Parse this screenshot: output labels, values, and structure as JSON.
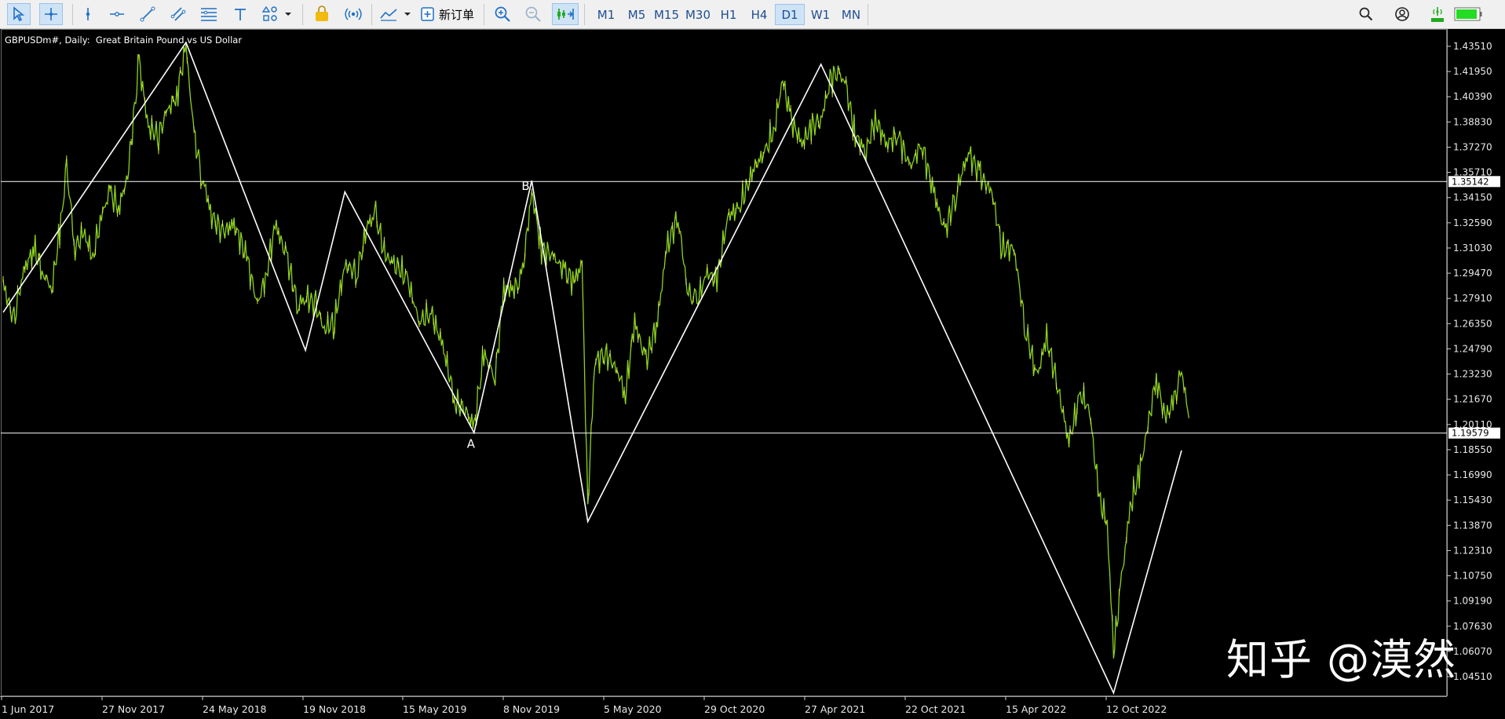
{
  "toolbar": {
    "order_label": "新订单",
    "timeframes": [
      "M1",
      "M5",
      "M15",
      "M30",
      "H1",
      "H4",
      "D1",
      "W1",
      "MN"
    ],
    "active_timeframe": "D1",
    "icons": [
      "cursor-arrow-icon",
      "crosshair-icon",
      "vertical-line-icon",
      "horizontal-line-icon",
      "trendline-icon",
      "channel-icon",
      "fibonacci-icon",
      "text-icon",
      "shapes-icon",
      "dropdown-icon",
      "bag-icon",
      "signal-icon",
      "indicator-icon",
      "dropdown-icon",
      "add-order-icon",
      "zoom-in-icon",
      "zoom-out-icon",
      "autoscroll-icon",
      "search-icon",
      "account-icon",
      "signal-level-icon",
      "battery-icon"
    ],
    "accent_color": "#1f6fc4",
    "level_color": "#22aa22"
  },
  "chart_title": "GBPUSDm#, Daily:  Great Britain Pound vs US Dollar",
  "watermark": "知乎 @漠然",
  "chart_data": {
    "type": "line",
    "title": "GBPUSDm#, Daily:  Great Britain Pound vs US Dollar",
    "xlabel": "",
    "ylabel": "",
    "ylim": [
      1.031,
      1.4415
    ],
    "y_ticks": [
      "1.43510",
      "1.41950",
      "1.40390",
      "1.38830",
      "1.37270",
      "1.35710",
      "1.34150",
      "1.32590",
      "1.31030",
      "1.29470",
      "1.27910",
      "1.26350",
      "1.24790",
      "1.23230",
      "1.21670",
      "1.20110",
      "1.18550",
      "1.16990",
      "1.15430",
      "1.13870",
      "1.12310",
      "1.10750",
      "1.09190",
      "1.07630",
      "1.06070",
      "1.04510"
    ],
    "x_ticks": [
      "1 Jun 2017",
      "27 Nov 2017",
      "24 May 2018",
      "19 Nov 2018",
      "15 May 2019",
      "8 Nov 2019",
      "5 May 2020",
      "29 Oct 2020",
      "27 Apr 2021",
      "22 Oct 2021",
      "15 Apr 2022",
      "12 Oct 2022"
    ],
    "price_line_color": "#8cd21e",
    "horizontal_lines": [
      {
        "value": 1.35142,
        "label": "1.35142"
      },
      {
        "value": 1.19579,
        "label": "1.19579"
      }
    ],
    "zigzag": [
      {
        "x": "2017-06-01",
        "y": 1.2705
      },
      {
        "x": "2018-04-17",
        "y": 1.4375
      },
      {
        "x": "2018-11-12",
        "y": 1.247
      },
      {
        "x": "2019-01-20",
        "y": 1.345
      },
      {
        "x": "2019-09-03",
        "y": 1.196
      },
      {
        "x": "2019-12-13",
        "y": 1.352
      },
      {
        "x": "2020-03-20",
        "y": 1.141
      },
      {
        "x": "2021-05-02",
        "y": 1.424
      },
      {
        "x": "2022-09-26",
        "y": 1.035
      },
      {
        "x": "2023-01-23",
        "y": 1.185
      }
    ],
    "point_labels": [
      {
        "text": "A",
        "x": "2019-09-03",
        "y": 1.196
      },
      {
        "text": "B",
        "x": "2019-12-13",
        "y": 1.352
      }
    ],
    "price_series": [
      {
        "x": "2017-06-01",
        "y": 1.288
      },
      {
        "x": "2017-06-20",
        "y": 1.265
      },
      {
        "x": "2017-07-05",
        "y": 1.295
      },
      {
        "x": "2017-07-25",
        "y": 1.31
      },
      {
        "x": "2017-08-10",
        "y": 1.295
      },
      {
        "x": "2017-08-25",
        "y": 1.285
      },
      {
        "x": "2017-09-10",
        "y": 1.325
      },
      {
        "x": "2017-09-20",
        "y": 1.36
      },
      {
        "x": "2017-10-05",
        "y": 1.31
      },
      {
        "x": "2017-10-20",
        "y": 1.32
      },
      {
        "x": "2017-11-05",
        "y": 1.305
      },
      {
        "x": "2017-11-20",
        "y": 1.33
      },
      {
        "x": "2017-12-05",
        "y": 1.345
      },
      {
        "x": "2017-12-20",
        "y": 1.335
      },
      {
        "x": "2018-01-05",
        "y": 1.355
      },
      {
        "x": "2018-01-25",
        "y": 1.425
      },
      {
        "x": "2018-02-10",
        "y": 1.385
      },
      {
        "x": "2018-02-28",
        "y": 1.38
      },
      {
        "x": "2018-03-15",
        "y": 1.395
      },
      {
        "x": "2018-04-01",
        "y": 1.405
      },
      {
        "x": "2018-04-17",
        "y": 1.435
      },
      {
        "x": "2018-05-01",
        "y": 1.38
      },
      {
        "x": "2018-05-15",
        "y": 1.355
      },
      {
        "x": "2018-06-01",
        "y": 1.33
      },
      {
        "x": "2018-06-20",
        "y": 1.32
      },
      {
        "x": "2018-07-10",
        "y": 1.325
      },
      {
        "x": "2018-08-01",
        "y": 1.305
      },
      {
        "x": "2018-08-20",
        "y": 1.275
      },
      {
        "x": "2018-09-05",
        "y": 1.295
      },
      {
        "x": "2018-09-20",
        "y": 1.325
      },
      {
        "x": "2018-10-10",
        "y": 1.305
      },
      {
        "x": "2018-10-30",
        "y": 1.275
      },
      {
        "x": "2018-11-12",
        "y": 1.28
      },
      {
        "x": "2018-11-30",
        "y": 1.275
      },
      {
        "x": "2018-12-15",
        "y": 1.26
      },
      {
        "x": "2019-01-02",
        "y": 1.265
      },
      {
        "x": "2019-01-20",
        "y": 1.3
      },
      {
        "x": "2019-02-10",
        "y": 1.295
      },
      {
        "x": "2019-03-01",
        "y": 1.325
      },
      {
        "x": "2019-03-15",
        "y": 1.33
      },
      {
        "x": "2019-04-01",
        "y": 1.305
      },
      {
        "x": "2019-04-20",
        "y": 1.3
      },
      {
        "x": "2019-05-10",
        "y": 1.29
      },
      {
        "x": "2019-05-30",
        "y": 1.265
      },
      {
        "x": "2019-06-20",
        "y": 1.27
      },
      {
        "x": "2019-07-10",
        "y": 1.25
      },
      {
        "x": "2019-08-01",
        "y": 1.215
      },
      {
        "x": "2019-08-20",
        "y": 1.21
      },
      {
        "x": "2019-09-03",
        "y": 1.199
      },
      {
        "x": "2019-09-20",
        "y": 1.245
      },
      {
        "x": "2019-10-10",
        "y": 1.23
      },
      {
        "x": "2019-10-25",
        "y": 1.285
      },
      {
        "x": "2019-11-10",
        "y": 1.285
      },
      {
        "x": "2019-11-25",
        "y": 1.29
      },
      {
        "x": "2019-12-13",
        "y": 1.345
      },
      {
        "x": "2019-12-30",
        "y": 1.31
      },
      {
        "x": "2020-01-20",
        "y": 1.305
      },
      {
        "x": "2020-02-10",
        "y": 1.295
      },
      {
        "x": "2020-02-25",
        "y": 1.29
      },
      {
        "x": "2020-03-10",
        "y": 1.3
      },
      {
        "x": "2020-03-20",
        "y": 1.15
      },
      {
        "x": "2020-04-01",
        "y": 1.24
      },
      {
        "x": "2020-04-20",
        "y": 1.245
      },
      {
        "x": "2020-05-10",
        "y": 1.235
      },
      {
        "x": "2020-05-25",
        "y": 1.22
      },
      {
        "x": "2020-06-10",
        "y": 1.265
      },
      {
        "x": "2020-06-30",
        "y": 1.24
      },
      {
        "x": "2020-07-20",
        "y": 1.265
      },
      {
        "x": "2020-08-05",
        "y": 1.31
      },
      {
        "x": "2020-08-25",
        "y": 1.33
      },
      {
        "x": "2020-09-10",
        "y": 1.285
      },
      {
        "x": "2020-09-25",
        "y": 1.275
      },
      {
        "x": "2020-10-15",
        "y": 1.295
      },
      {
        "x": "2020-11-01",
        "y": 1.29
      },
      {
        "x": "2020-11-20",
        "y": 1.33
      },
      {
        "x": "2020-12-10",
        "y": 1.335
      },
      {
        "x": "2021-01-05",
        "y": 1.36
      },
      {
        "x": "2021-01-25",
        "y": 1.37
      },
      {
        "x": "2021-02-10",
        "y": 1.385
      },
      {
        "x": "2021-02-24",
        "y": 1.415
      },
      {
        "x": "2021-03-10",
        "y": 1.39
      },
      {
        "x": "2021-03-30",
        "y": 1.375
      },
      {
        "x": "2021-04-15",
        "y": 1.385
      },
      {
        "x": "2021-05-02",
        "y": 1.39
      },
      {
        "x": "2021-05-20",
        "y": 1.415
      },
      {
        "x": "2021-06-01",
        "y": 1.42
      },
      {
        "x": "2021-06-15",
        "y": 1.41
      },
      {
        "x": "2021-07-01",
        "y": 1.38
      },
      {
        "x": "2021-07-20",
        "y": 1.37
      },
      {
        "x": "2021-08-05",
        "y": 1.39
      },
      {
        "x": "2021-08-25",
        "y": 1.375
      },
      {
        "x": "2021-09-15",
        "y": 1.38
      },
      {
        "x": "2021-10-05",
        "y": 1.36
      },
      {
        "x": "2021-10-25",
        "y": 1.375
      },
      {
        "x": "2021-11-15",
        "y": 1.345
      },
      {
        "x": "2021-12-05",
        "y": 1.32
      },
      {
        "x": "2021-12-25",
        "y": 1.345
      },
      {
        "x": "2022-01-15",
        "y": 1.37
      },
      {
        "x": "2022-02-05",
        "y": 1.355
      },
      {
        "x": "2022-02-25",
        "y": 1.345
      },
      {
        "x": "2022-03-15",
        "y": 1.31
      },
      {
        "x": "2022-04-05",
        "y": 1.31
      },
      {
        "x": "2022-04-25",
        "y": 1.26
      },
      {
        "x": "2022-05-15",
        "y": 1.23
      },
      {
        "x": "2022-06-01",
        "y": 1.255
      },
      {
        "x": "2022-06-20",
        "y": 1.225
      },
      {
        "x": "2022-07-10",
        "y": 1.19
      },
      {
        "x": "2022-07-30",
        "y": 1.22
      },
      {
        "x": "2022-08-15",
        "y": 1.21
      },
      {
        "x": "2022-09-01",
        "y": 1.155
      },
      {
        "x": "2022-09-15",
        "y": 1.14
      },
      {
        "x": "2022-09-26",
        "y": 1.06
      },
      {
        "x": "2022-10-10",
        "y": 1.105
      },
      {
        "x": "2022-10-25",
        "y": 1.15
      },
      {
        "x": "2022-11-10",
        "y": 1.17
      },
      {
        "x": "2022-11-25",
        "y": 1.2
      },
      {
        "x": "2022-12-10",
        "y": 1.23
      },
      {
        "x": "2022-12-25",
        "y": 1.205
      },
      {
        "x": "2023-01-10",
        "y": 1.215
      },
      {
        "x": "2023-01-23",
        "y": 1.235
      },
      {
        "x": "2023-02-05",
        "y": 1.205
      }
    ]
  }
}
